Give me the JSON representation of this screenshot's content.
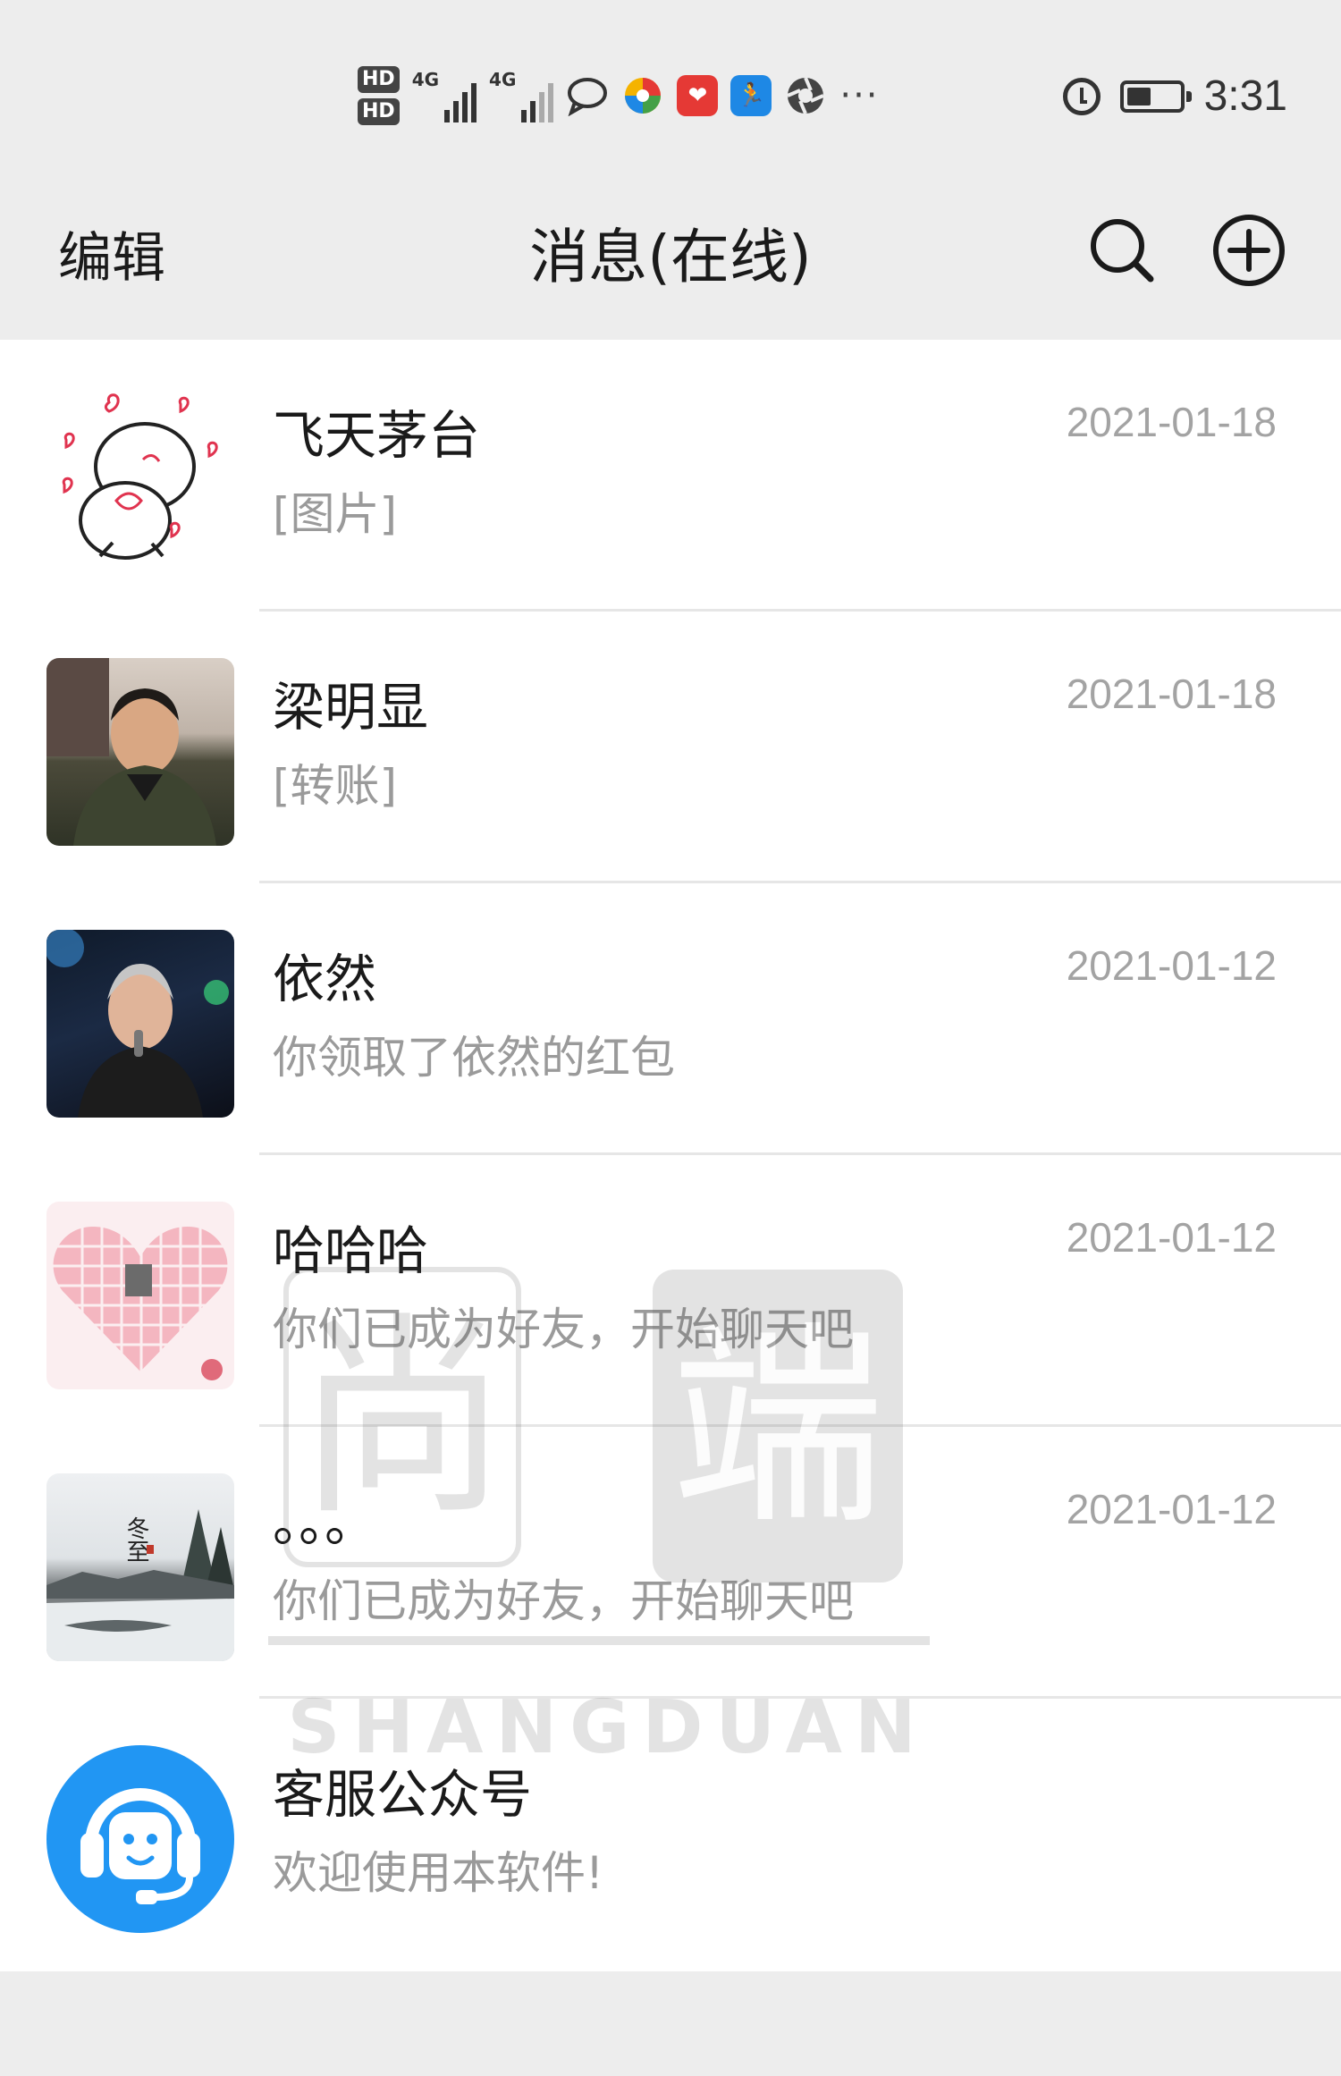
{
  "status_bar": {
    "time": "3:31",
    "sim1_label": "HD",
    "sim2_label": "HD",
    "network1": "4G",
    "network2": "4G",
    "more": "···"
  },
  "header": {
    "edit_label": "编辑",
    "title": "消息(在线)"
  },
  "conversations": [
    {
      "name": "飞天茅台",
      "preview": "[图片]",
      "date": "2021-01-18"
    },
    {
      "name": "梁明显",
      "preview": "[转账]",
      "date": "2021-01-18"
    },
    {
      "name": "依然",
      "preview": "你领取了依然的红包",
      "date": "2021-01-12"
    },
    {
      "name": "哈哈哈",
      "preview": "你们已成为好友，开始聊天吧",
      "date": "2021-01-12"
    },
    {
      "name": "。。。",
      "preview": "你们已成为好友，开始聊天吧",
      "date": "2021-01-12"
    },
    {
      "name": "客服公众号",
      "preview": "欢迎使用本软件!",
      "date": ""
    }
  ],
  "avatar_texts": {
    "winter": "冬至"
  },
  "watermark": {
    "text": "SHANGDUAN",
    "char1": "尚",
    "char2": "端"
  },
  "colors": {
    "background": "#ededed",
    "service_blue": "#2196f3",
    "date_gray": "#a3a3a3"
  }
}
